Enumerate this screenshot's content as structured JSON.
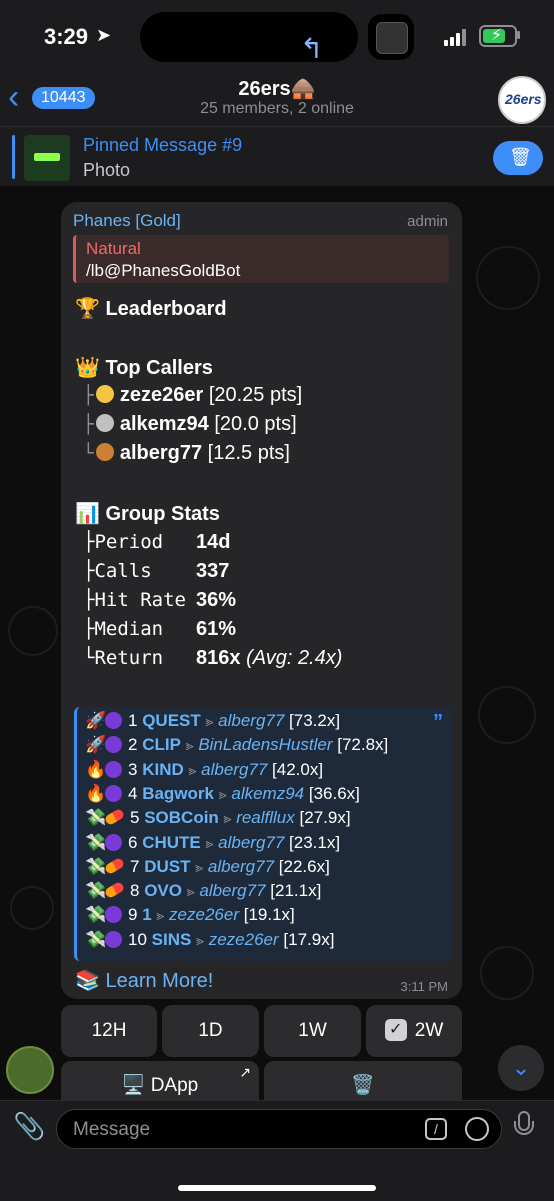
{
  "status": {
    "time": "3:29"
  },
  "header": {
    "back_count": "10443",
    "title": "26ers🛖",
    "subtitle": "25 members, 2 online",
    "group_logo_text": "26ers"
  },
  "pinned": {
    "title": "Pinned Message #9",
    "subtitle": "Photo"
  },
  "message": {
    "sender": "Phanes [Gold]",
    "role": "admin",
    "reply_name": "Natural",
    "reply_text": "/lb@PhanesGoldBot",
    "leaderboard_title": "🏆 Leaderboard",
    "top_callers_title": "👑 Top Callers",
    "callers": [
      {
        "tree": "├",
        "medal_color": "#f5c542",
        "name": "zeze26er",
        "pts": "[20.25 pts]"
      },
      {
        "tree": "├",
        "medal_color": "#c0c0c0",
        "name": "alkemz94",
        "pts": "[20.0 pts]"
      },
      {
        "tree": "└",
        "medal_color": "#cd7f32",
        "name": "alberg77",
        "pts": "[12.5 pts]"
      }
    ],
    "group_stats_title": "📊 Group Stats",
    "stats": [
      {
        "label": "├Period",
        "value": "14d",
        "extra": ""
      },
      {
        "label": "├Calls",
        "value": "337",
        "extra": ""
      },
      {
        "label": "├Hit Rate",
        "value": "36%",
        "extra": ""
      },
      {
        "label": "├Median",
        "value": "61%",
        "extra": ""
      },
      {
        "label": "└Return",
        "value": "816x",
        "extra": "(Avg: 2.4x)"
      }
    ],
    "quote_mark": "”",
    "tokens": [
      {
        "icon": "🚀",
        "badge": "dot",
        "rank": "1",
        "token": "QUEST",
        "caller": "alberg77",
        "mult": "[73.2x]"
      },
      {
        "icon": "🚀",
        "badge": "dot",
        "rank": "2",
        "token": "CLIP",
        "caller": "BinLadensHustler",
        "mult": "[72.8x]"
      },
      {
        "icon": "🔥",
        "badge": "dot",
        "rank": "3",
        "token": "KIND",
        "caller": "alberg77",
        "mult": "[42.0x]"
      },
      {
        "icon": "🔥",
        "badge": "dot",
        "rank": "4",
        "token": "Bagwork",
        "caller": "alkemz94",
        "mult": "[36.6x]"
      },
      {
        "icon": "💸",
        "badge": "pill",
        "rank": "5",
        "token": "SOBCoin",
        "caller": "realfllux",
        "mult": "[27.9x]"
      },
      {
        "icon": "💸",
        "badge": "dot",
        "rank": "6",
        "token": "CHUTE",
        "caller": "alberg77",
        "mult": "[23.1x]"
      },
      {
        "icon": "💸",
        "badge": "pill",
        "rank": "7",
        "token": "DUST",
        "caller": "alberg77",
        "mult": "[22.6x]"
      },
      {
        "icon": "💸",
        "badge": "pill",
        "rank": "8",
        "token": "OVO",
        "caller": "alberg77",
        "mult": "[21.1x]"
      },
      {
        "icon": "💸",
        "badge": "dot",
        "rank": "9",
        "token": "1",
        "caller": "zeze26er",
        "mult": "[19.1x]"
      },
      {
        "icon": "💸",
        "badge": "dot",
        "rank": "10",
        "token": "SINS",
        "caller": "zeze26er",
        "mult": "[17.9x]"
      }
    ],
    "arrow_glyph": "⪢",
    "learn_icon": "📚",
    "learn_more": "Learn More!",
    "time": "3:11 PM"
  },
  "keyboard": {
    "row1": [
      "12H",
      "1D",
      "1W",
      "2W"
    ],
    "selected": "2W",
    "check_glyph": "✓",
    "dapp_icon": "🖥️",
    "dapp_label": "DApp",
    "dapp_corner": "↗",
    "trash_icon": "🗑️"
  },
  "input": {
    "placeholder": "Message"
  },
  "icons": {
    "back": "chevron-left-icon",
    "location": "location-arrow-icon",
    "pin_action": "trash-icon",
    "attach": "paperclip-icon",
    "command": "slash-command-icon",
    "timer": "timer-icon",
    "mic": "microphone-icon",
    "scroll": "chevron-down-icon"
  },
  "colors": {
    "accent": "#3e8ef7",
    "link": "#6ab3f3",
    "reply": "#ef6b6b",
    "battery": "#34c759"
  }
}
